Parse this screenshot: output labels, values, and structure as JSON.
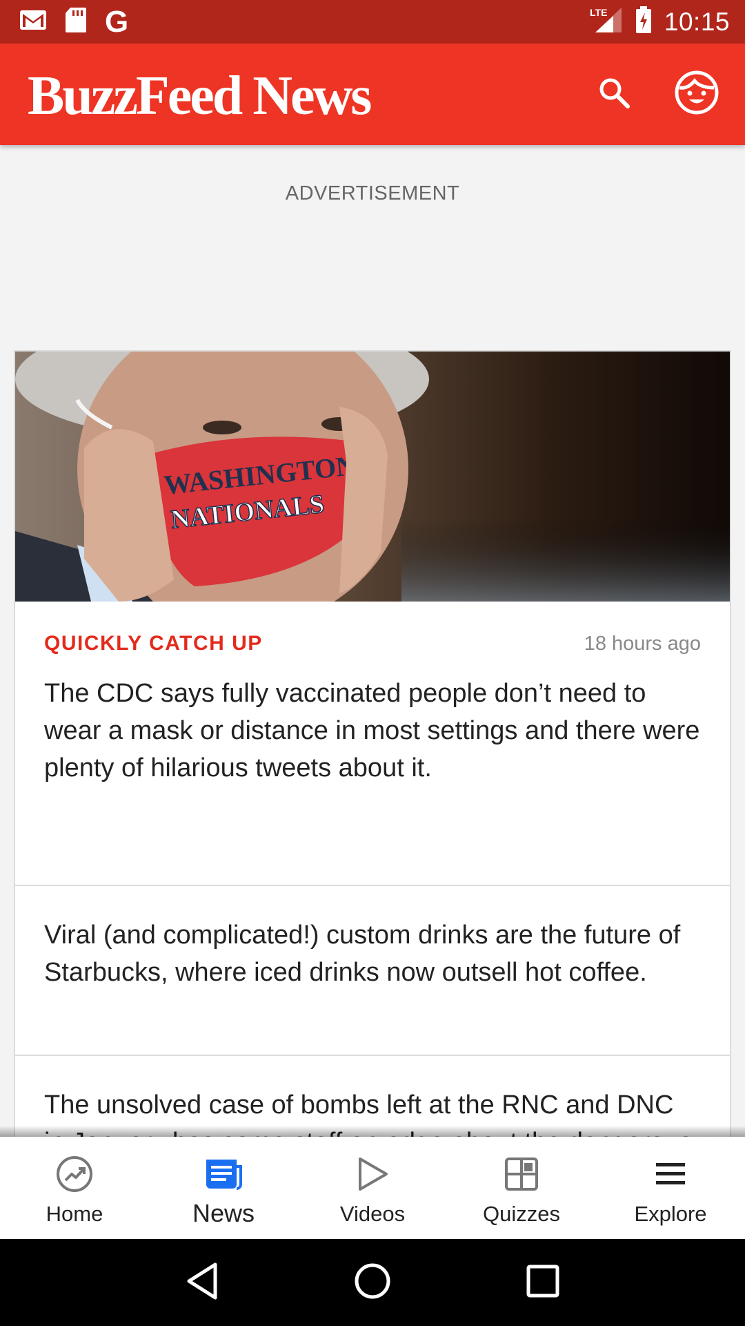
{
  "status_bar": {
    "time": "10:15",
    "network": "LTE",
    "left_icons": [
      "gmail-icon",
      "sd-card-icon",
      "google-icon"
    ],
    "google_letter": "G"
  },
  "app_bar": {
    "brand": "BuzzFeed News",
    "colors": {
      "brand_red": "#ee3424",
      "status_red": "#b1261b"
    }
  },
  "ad": {
    "label": "ADVERTISEMENT"
  },
  "feed": {
    "kicker": "QUICKLY CATCH UP",
    "timestamp": "18 hours ago",
    "stories": [
      "The CDC says fully vaccinated people don’t need to wear a mask or distance in most settings and there were plenty of hilarious tweets about it.",
      "Viral (and complicated!) custom drinks are the future of Starbucks, where iced drinks now outsell hot coffee.",
      "The unsolved case of bombs left at the RNC and DNC in January has some staff on edge about the dangerous state of American politics."
    ]
  },
  "bottom_nav": {
    "active": "News",
    "active_color": "#1a6ef0",
    "items": [
      {
        "label": "Home",
        "icon": "trending-icon"
      },
      {
        "label": "News",
        "icon": "news-icon"
      },
      {
        "label": "Videos",
        "icon": "play-icon"
      },
      {
        "label": "Quizzes",
        "icon": "quiz-grid-icon"
      },
      {
        "label": "Explore",
        "icon": "menu-icon"
      }
    ]
  }
}
